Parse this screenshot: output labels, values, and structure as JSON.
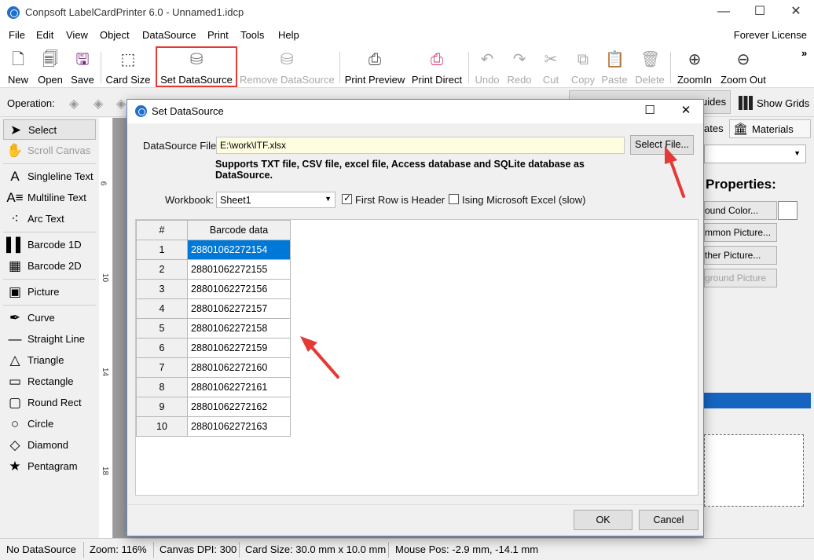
{
  "window": {
    "title": "Conpsoft LabelCardPrinter 6.0 - Unnamed1.idcp",
    "minimize": "—",
    "maximize": "☐",
    "close": "✕"
  },
  "menu": {
    "items": [
      "File",
      "Edit",
      "View",
      "Object",
      "DataSource",
      "Print",
      "Tools",
      "Help"
    ],
    "license": "Forever License"
  },
  "toolbar": {
    "new": "New",
    "open": "Open",
    "save": "Save",
    "card_size": "Card Size",
    "set_datasource": "Set DataSource",
    "remove_datasource": "Remove DataSource",
    "print_preview": "Print Preview",
    "print_direct": "Print Direct",
    "undo": "Undo",
    "redo": "Redo",
    "cut": "Cut",
    "copy": "Copy",
    "paste": "Paste",
    "delete": "Delete",
    "zoom_in": "ZoomIn",
    "zoom_out": "Zoom Out",
    "more": "»"
  },
  "operation": {
    "label": "Operation:",
    "guides": "uides",
    "show_grids": "Show Grids"
  },
  "tools": {
    "select": "Select",
    "scroll_canvas": "Scroll Canvas",
    "singleline_text": "Singleline Text",
    "multiline_text": "Multiline Text",
    "arc_text": "Arc Text",
    "barcode_1d": "Barcode 1D",
    "barcode_2d": "Barcode 2D",
    "picture": "Picture",
    "curve": "Curve",
    "straight_line": "Straight Line",
    "triangle": "Triangle",
    "rectangle": "Rectangle",
    "round_rect": "Round Rect",
    "circle": "Circle",
    "diamond": "Diamond",
    "pentagram": "Pentagram"
  },
  "ruler": {
    "marks": [
      "6",
      "10",
      "14",
      "18"
    ]
  },
  "right_panel": {
    "tab_templates": "ates",
    "tab_materials": "Materials",
    "properties_title": "Properties:",
    "btn_background_color": "ound Color...",
    "btn_common_picture": "mmon Picture...",
    "btn_other_picture": "ther Picture...",
    "btn_background_picture": "ground Picture"
  },
  "status": {
    "datasource": "No DataSource",
    "zoom": "Zoom: 116%",
    "dpi": "Canvas DPI: 300",
    "card_size": "Card Size: 30.0 mm x 10.0 mm",
    "mouse_pos": "Mouse Pos: -2.9 mm, -14.1 mm"
  },
  "dialog": {
    "title": "Set DataSource",
    "file_label": "DataSource File:",
    "file_value": "E:\\work\\ITF.xlsx",
    "select_file": "Select File...",
    "note": "Supports TXT file, CSV file, excel file, Access database and SQLite database as DataSource.",
    "workbook_label": "Workbook:",
    "workbook_value": "Sheet1",
    "first_row_header": "First Row is Header",
    "first_row_header_checked": true,
    "using_excel": "Ising Microsoft Excel (slow)",
    "using_excel_checked": false,
    "table": {
      "columns": [
        "#",
        "Barcode data"
      ],
      "rows": [
        [
          "1",
          "28801062272154"
        ],
        [
          "2",
          "28801062272155"
        ],
        [
          "3",
          "28801062272156"
        ],
        [
          "4",
          "28801062272157"
        ],
        [
          "5",
          "28801062272158"
        ],
        [
          "6",
          "28801062272159"
        ],
        [
          "7",
          "28801062272160"
        ],
        [
          "8",
          "28801062272161"
        ],
        [
          "9",
          "28801062272162"
        ],
        [
          "10",
          "28801062272163"
        ]
      ]
    },
    "ok": "OK",
    "cancel": "Cancel"
  },
  "colors": {
    "highlight_box": "#e53935",
    "arrow": "#e53935",
    "selection": "#0078d7",
    "file_field_bg": "#fffde0"
  }
}
